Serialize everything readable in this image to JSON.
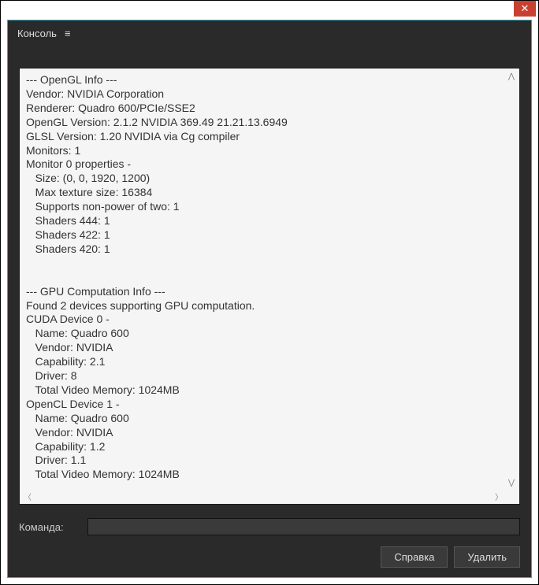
{
  "header": {
    "title": "Консоль"
  },
  "console": {
    "lines": [
      "--- OpenGL Info ---",
      "Vendor: NVIDIA Corporation",
      "Renderer: Quadro 600/PCIe/SSE2",
      "OpenGL Version: 2.1.2 NVIDIA 369.49 21.21.13.6949",
      "GLSL Version: 1.20 NVIDIA via Cg compiler",
      "Monitors: 1",
      "Monitor 0 properties -",
      "   Size: (0, 0, 1920, 1200)",
      "   Max texture size: 16384",
      "   Supports non-power of two: 1",
      "   Shaders 444: 1",
      "   Shaders 422: 1",
      "   Shaders 420: 1",
      "",
      "",
      "--- GPU Computation Info ---",
      "Found 2 devices supporting GPU computation.",
      "CUDA Device 0 -",
      "   Name: Quadro 600",
      "   Vendor: NVIDIA",
      "   Capability: 2.1",
      "   Driver: 8",
      "   Total Video Memory: 1024MB",
      "OpenCL Device 1 -",
      "   Name: Quadro 600",
      "   Vendor: NVIDIA",
      "   Capability: 1.2",
      "   Driver: 1.1",
      "   Total Video Memory: 1024MB"
    ]
  },
  "command": {
    "label": "Команда:",
    "value": ""
  },
  "buttons": {
    "help": "Справка",
    "delete": "Удалить"
  }
}
